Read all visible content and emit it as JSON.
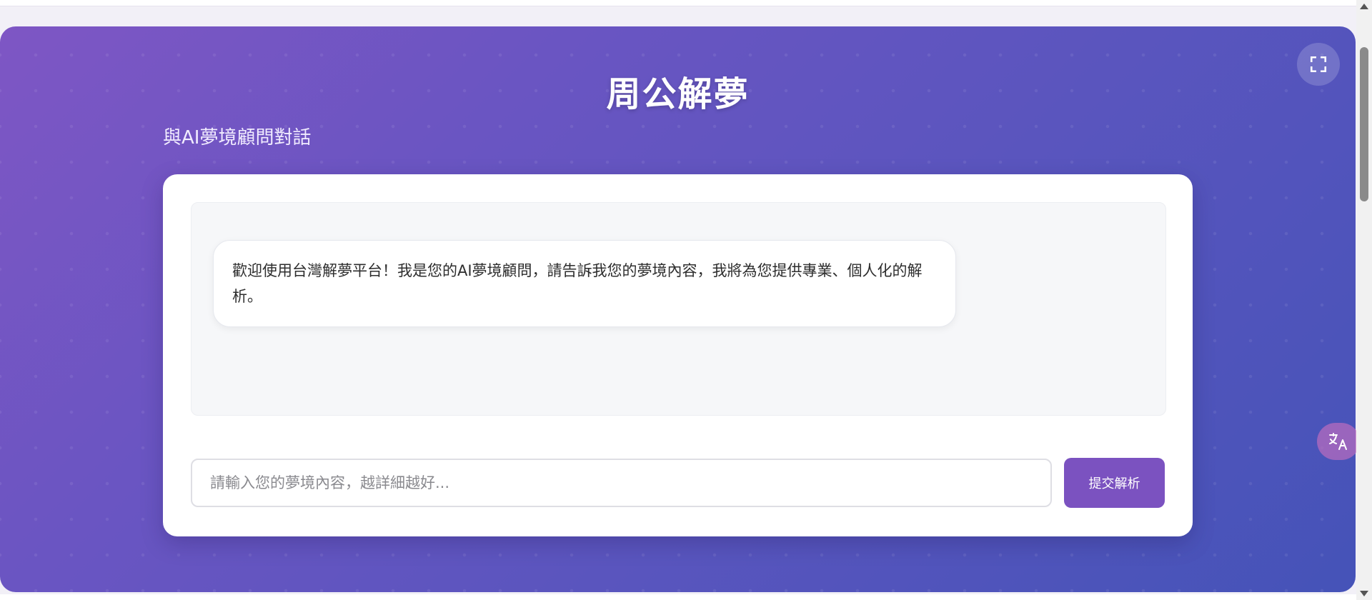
{
  "header": {
    "title": "周公解夢",
    "subtitle": "與AI夢境顧問對話"
  },
  "chat": {
    "messages": [
      {
        "role": "assistant",
        "text": "歡迎使用台灣解夢平台！我是您的AI夢境顧問，請告訴我您的夢境內容，我將為您提供專業、個人化的解析。"
      }
    ]
  },
  "input": {
    "placeholder": "請輸入您的夢境內容，越詳細越好...",
    "value": ""
  },
  "actions": {
    "submit_label": "提交解析"
  },
  "icons": {
    "fullscreen": "fullscreen-icon",
    "translate": "translate-icon"
  },
  "colors": {
    "gradient_start": "#7e56c4",
    "gradient_end": "#4553b8",
    "button": "#7b52c0"
  }
}
